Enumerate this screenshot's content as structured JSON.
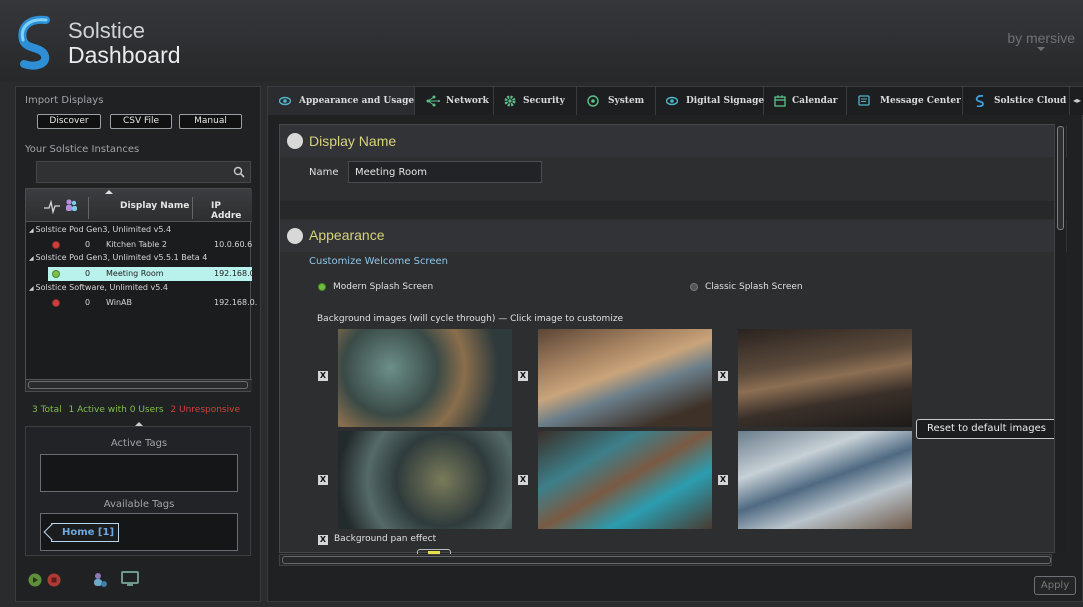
{
  "app": {
    "brand_line1": "Solstice",
    "brand_line2": "Dashboard",
    "by_line": "by mersive"
  },
  "left": {
    "import_label": "Import Displays",
    "buttons": [
      "Discover",
      "CSV File",
      "Manual"
    ],
    "instances_label": "Your Solstice Instances",
    "search": {
      "value": "",
      "placeholder": ""
    },
    "table": {
      "columns": [
        "Display Name",
        "IP Addre"
      ],
      "groups": [
        {
          "label": "Solstice Pod Gen3, Unlimited v5.4",
          "rows": [
            {
              "status": "red",
              "users": "0",
              "name": "Kitchen Table 2",
              "ip": "10.0.60.6"
            }
          ]
        },
        {
          "label": "Solstice Pod Gen3, Unlimited v5.5.1 Beta 4",
          "rows": [
            {
              "status": "green",
              "users": "0",
              "name": "Meeting Room",
              "ip": "192.168.0.",
              "selected": true
            }
          ]
        },
        {
          "label": "Solstice Software, Unlimited v5.4",
          "rows": [
            {
              "status": "red",
              "users": "0",
              "name": "WinAB",
              "ip": "192.168.0."
            }
          ]
        }
      ]
    },
    "stats": {
      "total": "3 Total",
      "active": "1 Active with 0 Users",
      "unresponsive": "2 Unresponsive"
    },
    "active_tags_label": "Active Tags",
    "available_tags_label": "Available Tags",
    "tags": [
      "Home [1]"
    ]
  },
  "tabs": [
    {
      "label": "Appearance and Usage",
      "icon": "eye-icon",
      "active": true
    },
    {
      "label": "Network",
      "icon": "network-icon"
    },
    {
      "label": "Security",
      "icon": "gear-icon"
    },
    {
      "label": "System",
      "icon": "power-icon"
    },
    {
      "label": "Digital Signage",
      "icon": "eye-icon"
    },
    {
      "label": "Calendar",
      "icon": "calendar-icon"
    },
    {
      "label": "Message Center",
      "icon": "message-icon"
    },
    {
      "label": "Solstice Cloud",
      "icon": "solstice-icon"
    }
  ],
  "display_name": {
    "title": "Display Name",
    "name_label": "Name",
    "name_value": "Meeting Room"
  },
  "appearance": {
    "title": "Appearance",
    "customize_label": "Customize Welcome Screen",
    "splash_options": [
      {
        "label": "Modern Splash Screen",
        "selected": true
      },
      {
        "label": "Classic Splash Screen",
        "selected": false
      }
    ],
    "bg_images_label": "Background images (will cycle through) — Click image to customize",
    "reset_button": "Reset to default images",
    "pan_effect_label": "Background pan effect",
    "pan_effect_checked": true,
    "x_mark": "X"
  },
  "apply_button": "Apply",
  "colors": {
    "accent_yellow": "#d7d27c",
    "header_text": "#e9ecee",
    "status_red": "#d0413e",
    "status_green": "#7cc04b",
    "selected_row": "#b9f2ec",
    "tag_blue": "#6ca9e0"
  }
}
